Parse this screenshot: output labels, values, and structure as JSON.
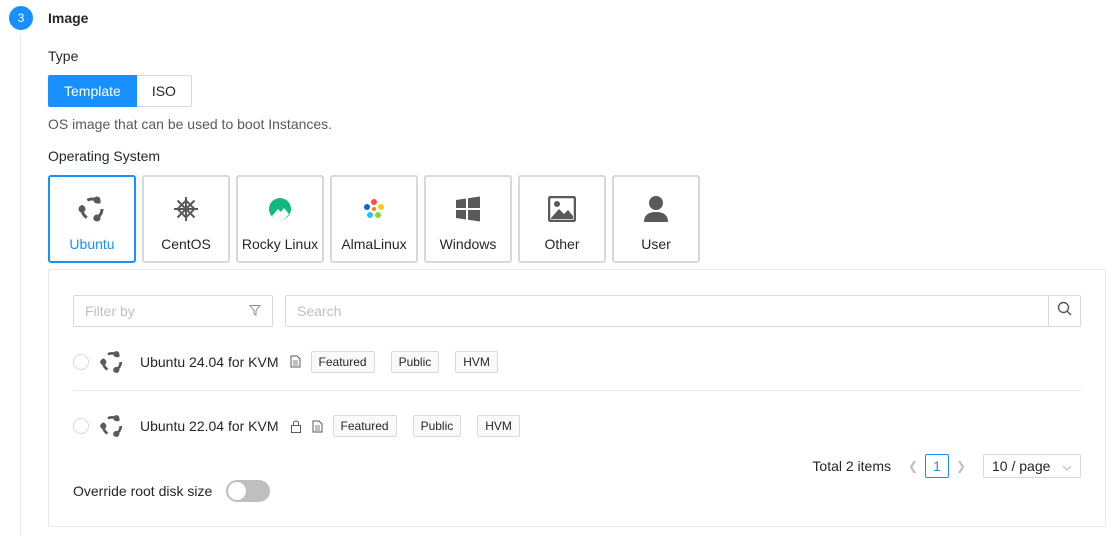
{
  "step": {
    "number": "3",
    "title": "Image"
  },
  "type_section": {
    "label": "Type",
    "options": [
      "Template",
      "ISO"
    ],
    "selected": "Template",
    "description": "OS image that can be used to boot Instances."
  },
  "os_section": {
    "label": "Operating System",
    "items": [
      {
        "label": "Ubuntu",
        "icon": "ubuntu-icon"
      },
      {
        "label": "CentOS",
        "icon": "centos-icon"
      },
      {
        "label": "Rocky Linux",
        "icon": "rocky-linux-icon"
      },
      {
        "label": "AlmaLinux",
        "icon": "almalinux-icon"
      },
      {
        "label": "Windows",
        "icon": "windows-icon"
      },
      {
        "label": "Other",
        "icon": "image-icon"
      },
      {
        "label": "User",
        "icon": "user-icon"
      }
    ],
    "selected": "Ubuntu"
  },
  "filter": {
    "placeholder": "Filter by"
  },
  "search": {
    "placeholder": "Search"
  },
  "templates": [
    {
      "name": "Ubuntu 24.04 for KVM",
      "tags": [
        "Featured",
        "Public",
        "HVM"
      ],
      "icons": [
        "file-icon"
      ]
    },
    {
      "name": "Ubuntu 22.04 for KVM",
      "tags": [
        "Featured",
        "Public",
        "HVM"
      ],
      "icons": [
        "lock-icon",
        "file-icon"
      ]
    }
  ],
  "pagination": {
    "total": "Total 2 items",
    "current_page": "1",
    "page_size": "10 / page"
  },
  "override": {
    "label": "Override root disk size",
    "enabled": false
  },
  "colors": {
    "primary": "#1890ff",
    "border": "#d9d9d9",
    "muted": "#bfbfbf"
  }
}
